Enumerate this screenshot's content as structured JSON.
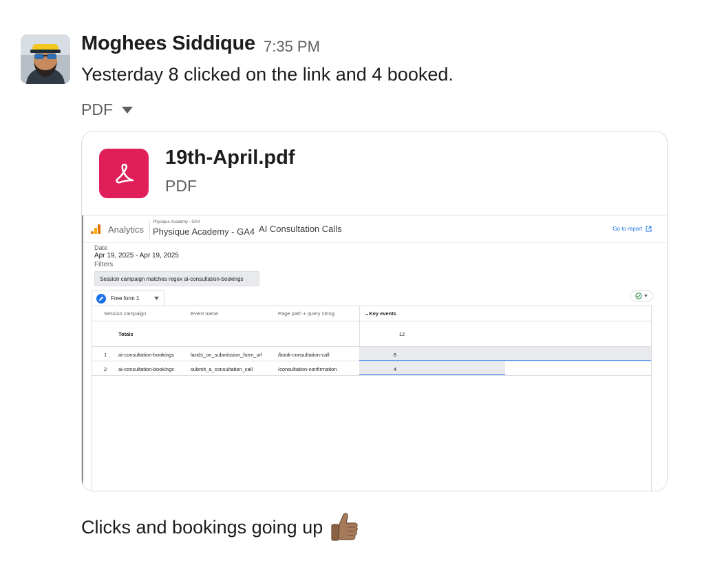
{
  "message": {
    "sender": "Moghees Siddique",
    "time": "7:35 PM",
    "text": "Yesterday 8 clicked on the link and 4 booked.",
    "attachment_toggle_label": "PDF",
    "caption": "Clicks and bookings going up",
    "caption_emoji": "thumbs-up-medium-skin-tone"
  },
  "attachment": {
    "file_name": "19th-April.pdf",
    "file_type": "PDF",
    "icon": "acrobat-icon",
    "icon_color": "#e01e5a"
  },
  "report": {
    "product": "Analytics",
    "property_small": "Physique Academy - GA4",
    "property": "Physique Academy - GA4",
    "report_name": "AI Consultation Calls",
    "go_to_report": "Go to report",
    "date_label": "Date",
    "date_range": "Apr 19, 2025 - Apr 19, 2025",
    "filters_label": "Filters",
    "filter": "Session campaign matches regex ai-consultation-bookings",
    "tab": "Free form 1",
    "columns": [
      "Session campaign",
      "Event name",
      "Page path + query string",
      "Key events"
    ],
    "totals_label": "Totals",
    "totals_value": "12",
    "rows": [
      {
        "index": "1",
        "campaign": "ai-consultation-bookings",
        "event": "lands_on_submission_form_url",
        "path": "/book-consultation-call",
        "value": "8",
        "share": 1.0
      },
      {
        "index": "2",
        "campaign": "ai-consultation-bookings",
        "event": "submit_a_consultation_call",
        "path": "/consultation-confirmation",
        "value": "4",
        "share": 0.5
      }
    ],
    "accent": "#1a73e8"
  }
}
